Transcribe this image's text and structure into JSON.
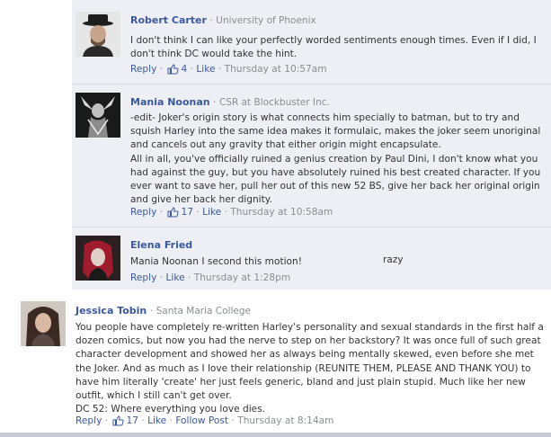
{
  "comments": [
    {
      "name": "Robert Carter",
      "affiliation": "University of Phoenix",
      "text": [
        "I don't think I can like your perfectly worded sentiments enough times. Even if I did, I don't think DC would take the hint."
      ],
      "actions": {
        "reply": "Reply",
        "like_count": "4",
        "like": "Like",
        "timestamp": "Thursday at 10:57am"
      }
    },
    {
      "name": "Mania Noonan",
      "affiliation": "CSR at Blockbuster Inc.",
      "text": [
        "-edit- Joker's origin story is what connects him specially to batman, but to try and squish Harley into the same idea makes it formulaic, makes the joker seem unoriginal and cancels out any gravity that either origin might encapsulate.",
        "All in all, you've officially ruined a genius creation by Paul Dini, I don't know what you had against the guy, but you have absolutely ruined his best created character. If you ever want to save her, pull her out of this new 52 BS, give her back her original origin and give her back her dignity."
      ],
      "actions": {
        "reply": "Reply",
        "like_count": "17",
        "like": "Like",
        "timestamp": "Thursday at 10:58am"
      }
    },
    {
      "name": "Elena Fried",
      "affiliation": "",
      "text": [
        "Mania Noonan I second this motion!"
      ],
      "stray_text": "razy",
      "actions": {
        "reply": "Reply",
        "like": "Like",
        "timestamp": "Thursday at 1:28pm"
      }
    },
    {
      "name": "Jessica Tobin",
      "affiliation": "Santa Maria College",
      "text": [
        "You people have completely re-written Harley's personality and sexual standards in the first half a dozen comics, but now you had the nerve to step on her backstory? It was once full of such great character development and showed her as always being mentally skewed, even before she met the Joker. And as much as I love their relationship (REUNITE THEM, PLEASE AND THANK YOU) to have him literally 'create' her just feels generic, bland and just plain stupid. Much like her new outfit, which I still can't get over.",
        "DC 52: Where everything you love dies."
      ],
      "actions": {
        "reply": "Reply",
        "like_count": "17",
        "like": "Like",
        "follow": "Follow Post",
        "timestamp": "Thursday at 8:14am"
      }
    }
  ],
  "separator": "·"
}
